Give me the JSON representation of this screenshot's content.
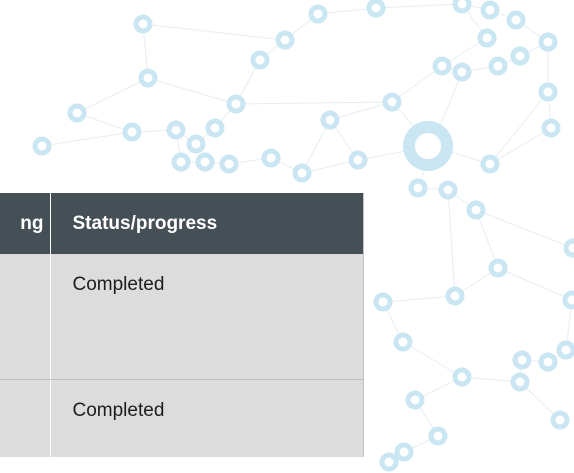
{
  "table": {
    "columns": [
      {
        "label": "ng"
      },
      {
        "label": "Status/progress"
      }
    ],
    "rows": [
      {
        "left": "",
        "status": "Completed"
      },
      {
        "left": "",
        "status": "Completed"
      }
    ]
  },
  "colors": {
    "header_bg": "#454f56",
    "header_text": "#ffffff",
    "cell_bg": "#dcdcdc",
    "network_node": "#c9e6f2"
  }
}
